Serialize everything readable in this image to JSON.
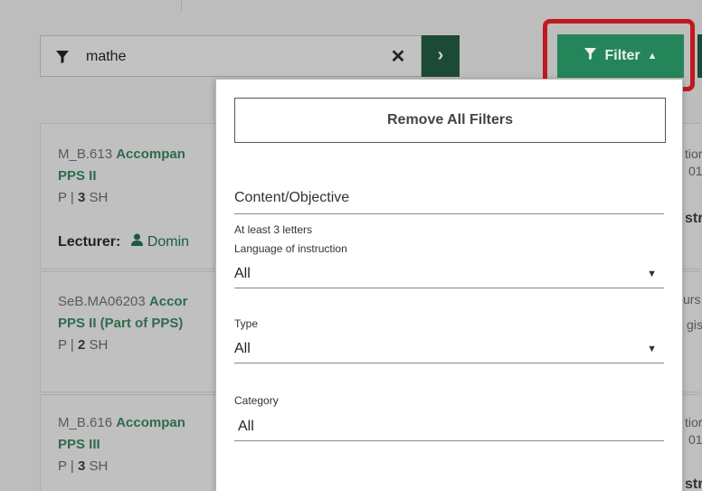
{
  "search": {
    "value": "mathe",
    "clear_symbol": "✕",
    "go_symbol": "›"
  },
  "filter_button": {
    "label": "Filter",
    "caret": "▲"
  },
  "cards": [
    {
      "code": "M_B.613",
      "title": "Accompan",
      "sub": "PPS II",
      "type": "P",
      "hours": "3",
      "unit": "SH",
      "lecturer_label": "Lecturer:",
      "lecturer": "Domin",
      "side1": "tior",
      "side2": "01",
      "side3": "str"
    },
    {
      "code": "SeB.MA06203",
      "title": "Accor",
      "sub": "PPS II (Part of PPS)",
      "type": "P",
      "hours": "2",
      "unit": "SH",
      "side1": "urs",
      "side2": "gis"
    },
    {
      "code": "M_B.616",
      "title": "Accompan",
      "sub": "PPS III",
      "type": "P",
      "hours": "3",
      "unit": "SH",
      "side1": "tior",
      "side2": "01",
      "side3": "str"
    }
  ],
  "panel": {
    "remove_all": "Remove All Filters",
    "content_objective": "Content/Objective",
    "hint": "At least 3 letters",
    "language_label": "Language of instruction",
    "language_value": "All",
    "type_label": "Type",
    "type_value": "All",
    "category_label": "Category",
    "category_value": "All",
    "dropdown_arrow": "▼"
  }
}
